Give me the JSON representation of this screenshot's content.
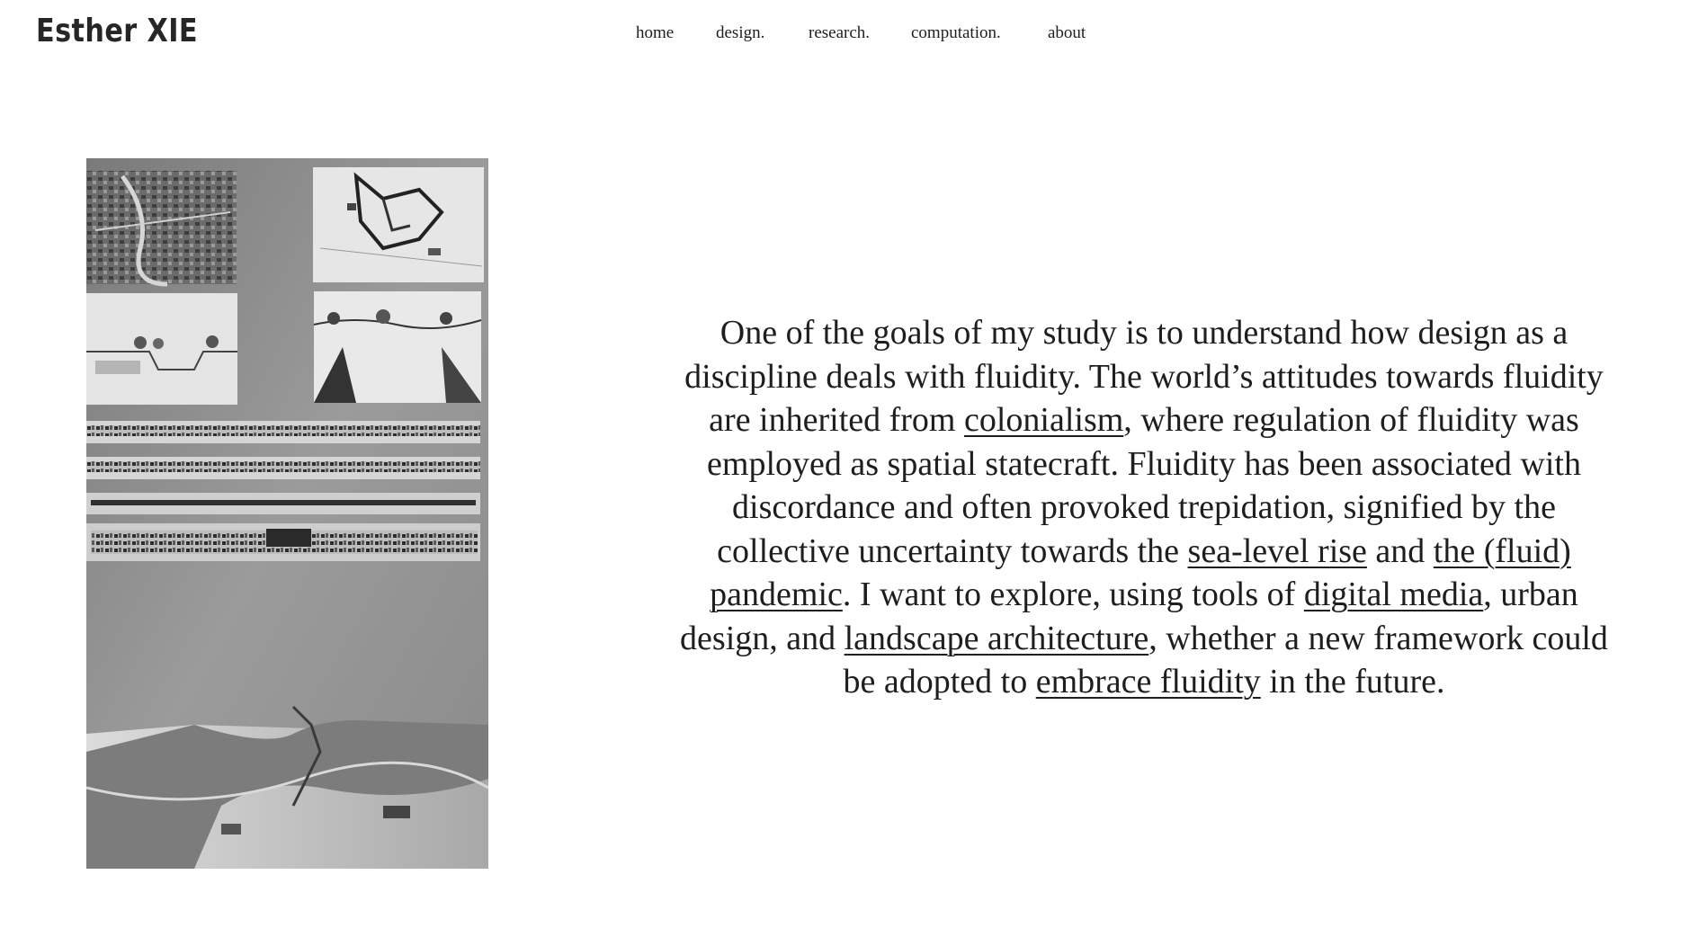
{
  "header": {
    "site_title": "Esther XIE",
    "nav": [
      {
        "label": "home"
      },
      {
        "label": "design."
      },
      {
        "label": "research."
      },
      {
        "label": "computation."
      },
      {
        "label": "about"
      }
    ]
  },
  "main": {
    "statement": {
      "t1": "One of the goals of my study is to understand how design as a discipline deals with fluidity. The world’s attitudes towards fluidity are inherited from ",
      "link1": "colonialism",
      "t2": ", where regulation of fluidity was employed as spatial statecraft. Fluidity has been associated with discordance and often provoked trepidation, signified by the collective uncertainty towards the ",
      "link2": "sea-level rise",
      "t3": " and ",
      "link3": "the (fluid) pandemic",
      "t4": ". I want to explore, using tools of ",
      "link4": "digital media",
      "t5": ", urban design, and ",
      "link5": "landscape architecture",
      "t6": ", whether a new framework could be adopted to ",
      "link6": "embrace fluidity",
      "t7": " in the future."
    }
  },
  "colors": {
    "text": "#1e1e1e",
    "background": "#ffffff",
    "photo_board": "#8a8a8a"
  }
}
